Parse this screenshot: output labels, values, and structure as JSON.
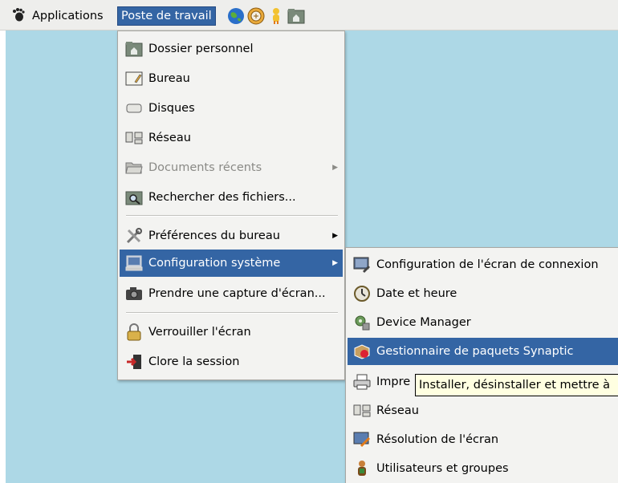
{
  "panel": {
    "applications_label": "Applications",
    "poste_label": "Poste de travail",
    "launchers": [
      "web-browser-icon",
      "mail-icon",
      "messenger-icon",
      "home-folder-icon"
    ]
  },
  "main_menu": {
    "items": [
      {
        "label": "Dossier personnel",
        "icon": "home-folder-icon"
      },
      {
        "label": "Bureau",
        "icon": "desktop-icon"
      },
      {
        "label": "Disques",
        "icon": "drive-icon"
      },
      {
        "label": "Réseau",
        "icon": "network-icon"
      },
      {
        "label": "Documents récents",
        "icon": "folder-open-icon",
        "disabled": true,
        "submenu": true
      },
      {
        "label": "Rechercher des fichiers...",
        "icon": "search-folder-icon"
      },
      {
        "label": "Préférences du bureau",
        "icon": "tools-icon",
        "submenu": true
      },
      {
        "label": "Configuration système",
        "icon": "computer-icon",
        "submenu": true,
        "selected": true
      },
      {
        "label": "Prendre une capture d'écran...",
        "icon": "camera-icon"
      },
      {
        "label": "Verrouiller l'écran",
        "icon": "lock-icon"
      },
      {
        "label": "Clore la session",
        "icon": "logout-icon"
      }
    ]
  },
  "submenu": {
    "items": [
      {
        "label": "Configuration de l'écran de connexion",
        "icon": "login-screen-icon"
      },
      {
        "label": "Date et heure",
        "icon": "clock-icon"
      },
      {
        "label": "Device Manager",
        "icon": "device-manager-icon"
      },
      {
        "label": "Gestionnaire de paquets Synaptic",
        "icon": "package-icon",
        "selected": true
      },
      {
        "label": "Impre",
        "icon": "printer-icon"
      },
      {
        "label": "Réseau",
        "icon": "network-icon"
      },
      {
        "label": "Résolution de l'écran",
        "icon": "display-icon"
      },
      {
        "label": "Utilisateurs et groupes",
        "icon": "users-icon"
      }
    ]
  },
  "tooltip": {
    "text": "Installer, désinstaller et mettre à"
  }
}
